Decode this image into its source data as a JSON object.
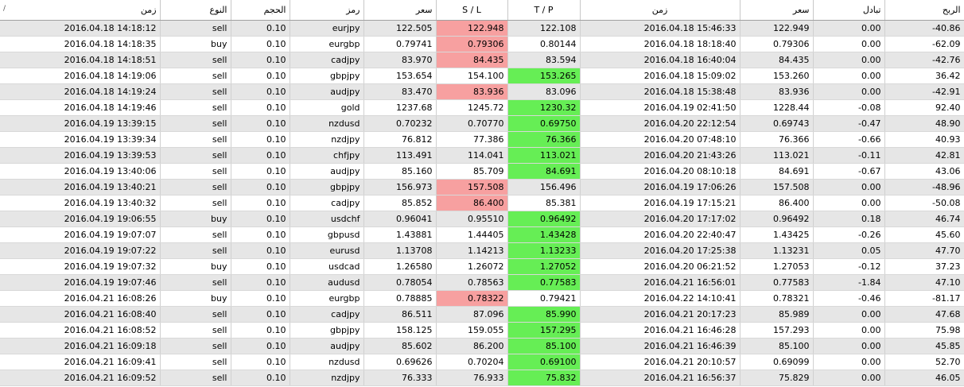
{
  "columns": [
    {
      "key": "open_time",
      "label": "زمن"
    },
    {
      "key": "type",
      "label": "النوع"
    },
    {
      "key": "volume",
      "label": "الحجم"
    },
    {
      "key": "symbol",
      "label": "رمز"
    },
    {
      "key": "open_price",
      "label": "سعر"
    },
    {
      "key": "sl",
      "label": "S / L"
    },
    {
      "key": "tp",
      "label": "T / P"
    },
    {
      "key": "close_time",
      "label": "زمن"
    },
    {
      "key": "close_price",
      "label": "سعر"
    },
    {
      "key": "swap",
      "label": "تبادل"
    },
    {
      "key": "profit",
      "label": "الربح"
    }
  ],
  "sort_icon": "/",
  "highlight_colors": {
    "sl_hit": "#f7a0a0",
    "tp_hit": "#66ee55"
  },
  "rows": [
    {
      "open_time": "2016.04.18 14:18:12",
      "type": "sell",
      "volume": "0.10",
      "symbol": "eurjpy",
      "open_price": "122.505",
      "sl": "122.948",
      "tp": "122.108",
      "close_time": "2016.04.18 15:46:33",
      "close_price": "122.949",
      "swap": "0.00",
      "profit": "-40.86",
      "hit": "sl"
    },
    {
      "open_time": "2016.04.18 14:18:35",
      "type": "buy",
      "volume": "0.10",
      "symbol": "eurgbp",
      "open_price": "0.79741",
      "sl": "0.79306",
      "tp": "0.80144",
      "close_time": "2016.04.18 18:18:40",
      "close_price": "0.79306",
      "swap": "0.00",
      "profit": "-62.09",
      "hit": "sl"
    },
    {
      "open_time": "2016.04.18 14:18:51",
      "type": "sell",
      "volume": "0.10",
      "symbol": "cadjpy",
      "open_price": "83.970",
      "sl": "84.435",
      "tp": "83.594",
      "close_time": "2016.04.18 16:40:04",
      "close_price": "84.435",
      "swap": "0.00",
      "profit": "-42.76",
      "hit": "sl"
    },
    {
      "open_time": "2016.04.18 14:19:06",
      "type": "sell",
      "volume": "0.10",
      "symbol": "gbpjpy",
      "open_price": "153.654",
      "sl": "154.100",
      "tp": "153.265",
      "close_time": "2016.04.18 15:09:02",
      "close_price": "153.260",
      "swap": "0.00",
      "profit": "36.42",
      "hit": "tp"
    },
    {
      "open_time": "2016.04.18 14:19:24",
      "type": "sell",
      "volume": "0.10",
      "symbol": "audjpy",
      "open_price": "83.470",
      "sl": "83.936",
      "tp": "83.096",
      "close_time": "2016.04.18 15:38:48",
      "close_price": "83.936",
      "swap": "0.00",
      "profit": "-42.91",
      "hit": "sl"
    },
    {
      "open_time": "2016.04.18 14:19:46",
      "type": "sell",
      "volume": "0.10",
      "symbol": "gold",
      "open_price": "1237.68",
      "sl": "1245.72",
      "tp": "1230.32",
      "close_time": "2016.04.19 02:41:50",
      "close_price": "1228.44",
      "swap": "-0.08",
      "profit": "92.40",
      "hit": "tp"
    },
    {
      "open_time": "2016.04.19 13:39:15",
      "type": "sell",
      "volume": "0.10",
      "symbol": "nzdusd",
      "open_price": "0.70232",
      "sl": "0.70770",
      "tp": "0.69750",
      "close_time": "2016.04.20 22:12:54",
      "close_price": "0.69743",
      "swap": "-0.47",
      "profit": "48.90",
      "hit": "tp"
    },
    {
      "open_time": "2016.04.19 13:39:34",
      "type": "sell",
      "volume": "0.10",
      "symbol": "nzdjpy",
      "open_price": "76.812",
      "sl": "77.386",
      "tp": "76.366",
      "close_time": "2016.04.20 07:48:10",
      "close_price": "76.366",
      "swap": "-0.66",
      "profit": "40.93",
      "hit": "tp"
    },
    {
      "open_time": "2016.04.19 13:39:53",
      "type": "sell",
      "volume": "0.10",
      "symbol": "chfjpy",
      "open_price": "113.491",
      "sl": "114.041",
      "tp": "113.021",
      "close_time": "2016.04.20 21:43:26",
      "close_price": "113.021",
      "swap": "-0.11",
      "profit": "42.81",
      "hit": "tp"
    },
    {
      "open_time": "2016.04.19 13:40:06",
      "type": "sell",
      "volume": "0.10",
      "symbol": "audjpy",
      "open_price": "85.160",
      "sl": "85.709",
      "tp": "84.691",
      "close_time": "2016.04.20 08:10:18",
      "close_price": "84.691",
      "swap": "-0.67",
      "profit": "43.06",
      "hit": "tp"
    },
    {
      "open_time": "2016.04.19 13:40:21",
      "type": "sell",
      "volume": "0.10",
      "symbol": "gbpjpy",
      "open_price": "156.973",
      "sl": "157.508",
      "tp": "156.496",
      "close_time": "2016.04.19 17:06:26",
      "close_price": "157.508",
      "swap": "0.00",
      "profit": "-48.96",
      "hit": "sl"
    },
    {
      "open_time": "2016.04.19 13:40:32",
      "type": "sell",
      "volume": "0.10",
      "symbol": "cadjpy",
      "open_price": "85.852",
      "sl": "86.400",
      "tp": "85.381",
      "close_time": "2016.04.19 17:15:21",
      "close_price": "86.400",
      "swap": "0.00",
      "profit": "-50.08",
      "hit": "sl"
    },
    {
      "open_time": "2016.04.19 19:06:55",
      "type": "buy",
      "volume": "0.10",
      "symbol": "usdchf",
      "open_price": "0.96041",
      "sl": "0.95510",
      "tp": "0.96492",
      "close_time": "2016.04.20 17:17:02",
      "close_price": "0.96492",
      "swap": "0.18",
      "profit": "46.74",
      "hit": "tp"
    },
    {
      "open_time": "2016.04.19 19:07:07",
      "type": "sell",
      "volume": "0.10",
      "symbol": "gbpusd",
      "open_price": "1.43881",
      "sl": "1.44405",
      "tp": "1.43428",
      "close_time": "2016.04.20 22:40:47",
      "close_price": "1.43425",
      "swap": "-0.26",
      "profit": "45.60",
      "hit": "tp"
    },
    {
      "open_time": "2016.04.19 19:07:22",
      "type": "sell",
      "volume": "0.10",
      "symbol": "eurusd",
      "open_price": "1.13708",
      "sl": "1.14213",
      "tp": "1.13233",
      "close_time": "2016.04.20 17:25:38",
      "close_price": "1.13231",
      "swap": "0.05",
      "profit": "47.70",
      "hit": "tp"
    },
    {
      "open_time": "2016.04.19 19:07:32",
      "type": "buy",
      "volume": "0.10",
      "symbol": "usdcad",
      "open_price": "1.26580",
      "sl": "1.26072",
      "tp": "1.27052",
      "close_time": "2016.04.20 06:21:52",
      "close_price": "1.27053",
      "swap": "-0.12",
      "profit": "37.23",
      "hit": "tp"
    },
    {
      "open_time": "2016.04.19 19:07:46",
      "type": "sell",
      "volume": "0.10",
      "symbol": "audusd",
      "open_price": "0.78054",
      "sl": "0.78563",
      "tp": "0.77583",
      "close_time": "2016.04.21 16:56:01",
      "close_price": "0.77583",
      "swap": "-1.84",
      "profit": "47.10",
      "hit": "tp"
    },
    {
      "open_time": "2016.04.21 16:08:26",
      "type": "buy",
      "volume": "0.10",
      "symbol": "eurgbp",
      "open_price": "0.78885",
      "sl": "0.78322",
      "tp": "0.79421",
      "close_time": "2016.04.22 14:10:41",
      "close_price": "0.78321",
      "swap": "-0.46",
      "profit": "-81.17",
      "hit": "sl"
    },
    {
      "open_time": "2016.04.21 16:08:40",
      "type": "sell",
      "volume": "0.10",
      "symbol": "cadjpy",
      "open_price": "86.511",
      "sl": "87.096",
      "tp": "85.990",
      "close_time": "2016.04.21 20:17:23",
      "close_price": "85.989",
      "swap": "0.00",
      "profit": "47.68",
      "hit": "tp"
    },
    {
      "open_time": "2016.04.21 16:08:52",
      "type": "sell",
      "volume": "0.10",
      "symbol": "gbpjpy",
      "open_price": "158.125",
      "sl": "159.055",
      "tp": "157.295",
      "close_time": "2016.04.21 16:46:28",
      "close_price": "157.293",
      "swap": "0.00",
      "profit": "75.98",
      "hit": "tp"
    },
    {
      "open_time": "2016.04.21 16:09:18",
      "type": "sell",
      "volume": "0.10",
      "symbol": "audjpy",
      "open_price": "85.602",
      "sl": "86.200",
      "tp": "85.100",
      "close_time": "2016.04.21 16:46:39",
      "close_price": "85.100",
      "swap": "0.00",
      "profit": "45.85",
      "hit": "tp"
    },
    {
      "open_time": "2016.04.21 16:09:41",
      "type": "sell",
      "volume": "0.10",
      "symbol": "nzdusd",
      "open_price": "0.69626",
      "sl": "0.70204",
      "tp": "0.69100",
      "close_time": "2016.04.21 20:10:57",
      "close_price": "0.69099",
      "swap": "0.00",
      "profit": "52.70",
      "hit": "tp"
    },
    {
      "open_time": "2016.04.21 16:09:52",
      "type": "sell",
      "volume": "0.10",
      "symbol": "nzdjpy",
      "open_price": "76.333",
      "sl": "76.933",
      "tp": "75.832",
      "close_time": "2016.04.21 16:56:37",
      "close_price": "75.829",
      "swap": "0.00",
      "profit": "46.05",
      "hit": "tp"
    }
  ]
}
